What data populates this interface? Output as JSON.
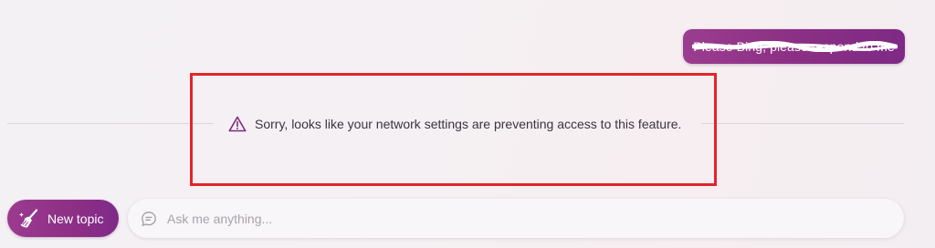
{
  "conversation": {
    "user_message": "Please Bing, please respond to me"
  },
  "notice": {
    "icon": "warning-triangle-icon",
    "text": "Sorry, looks like your network settings are preventing access to this feature."
  },
  "composer": {
    "new_topic_label": "New topic",
    "new_topic_icon": "broom-icon",
    "input_value": "",
    "input_placeholder": "Ask me anything...",
    "input_icon": "chat-bubble-icon"
  },
  "colors": {
    "accent": "#8d2f86",
    "highlight_border": "#e3242b",
    "warning_icon": "#7d2a7e"
  }
}
